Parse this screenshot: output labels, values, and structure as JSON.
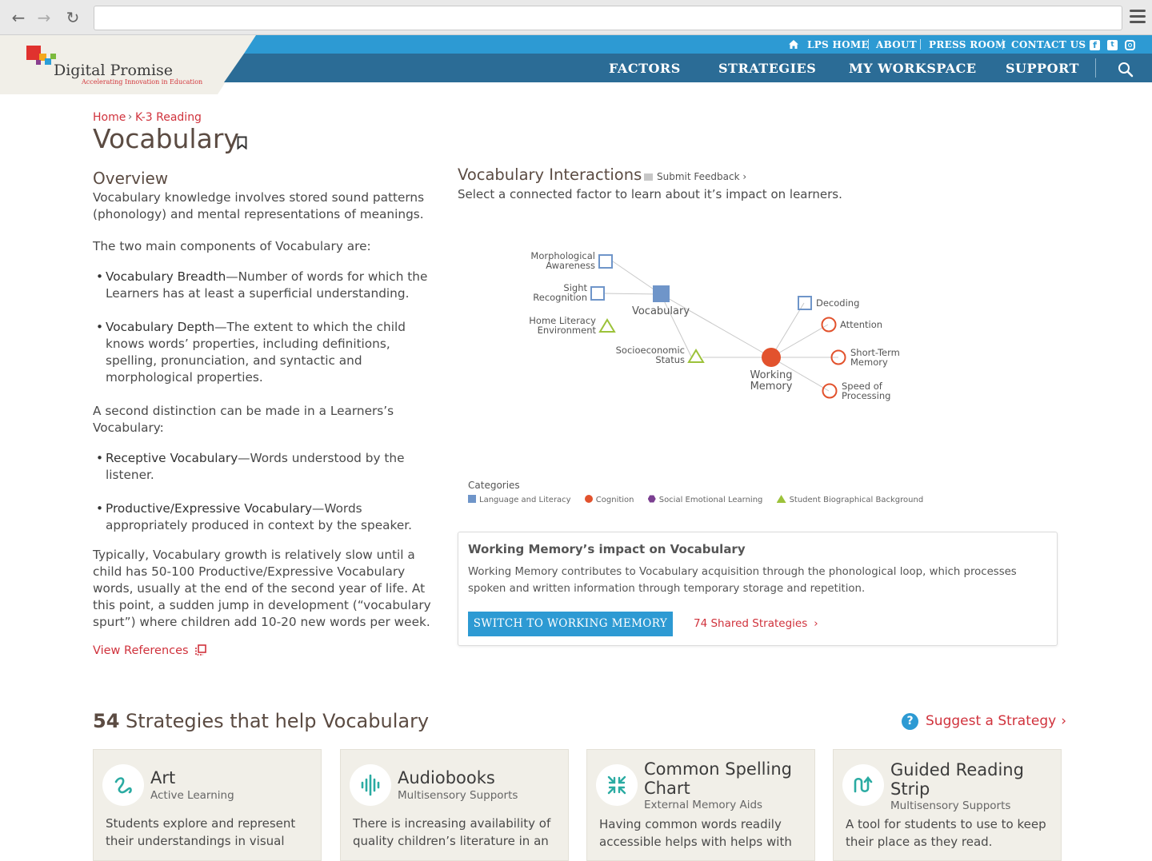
{
  "header": {
    "logo_title": "Digital Promise",
    "logo_tagline": "Accelerating Innovation in Education",
    "utility_links": [
      "LPS HOME",
      "ABOUT",
      "PRESS ROOM",
      "CONTACT US"
    ],
    "main_nav": [
      "FACTORS",
      "STRATEGIES",
      "MY WORKSPACE",
      "SUPPORT"
    ]
  },
  "breadcrumb": {
    "home": "Home",
    "sep": "›",
    "current": "K-3 Reading"
  },
  "page": {
    "title": "Vocabulary"
  },
  "overview": {
    "heading": "Overview",
    "intro": "Vocabulary knowledge involves stored sound patterns (phonology) and mental representations of meanings.",
    "components_intro": "The two main components of Vocabulary are:",
    "components": [
      {
        "term": "Vocabulary Breadth",
        "desc": "—Number of words for which the Learners has at least a superficial understanding."
      },
      {
        "term": "Vocabulary Depth",
        "desc": "—The extent to which the child knows words’ properties, including definitions, spelling, pronunciation, and syntactic and morphological properties."
      }
    ],
    "distinction_intro": "A second distinction can be made in a Learners’s Vocabulary:",
    "distinctions": [
      {
        "term": "Receptive Vocabulary",
        "desc": "—Words understood by the listener."
      },
      {
        "term": "Productive/Expressive Vocabulary",
        "desc": "—Words appropriately produced in context by the speaker."
      }
    ],
    "closing": "Typically, Vocabulary growth is relatively slow until a child has 50-100 Productive/Expressive Vocabulary words, usually at the end of the second year of life. At this point, a sudden jump in development (“vocabulary spurt”) where children add 10-20 new words per week.",
    "view_references": "View References"
  },
  "interactions": {
    "title": "Vocabulary Interactions",
    "feedback": "Submit Feedback ›",
    "subtitle": "Select a connected factor to learn about it’s impact on learners.",
    "nodes": {
      "morph_1": "Morphological",
      "morph_2": "Awareness",
      "sight_1": "Sight",
      "sight_2": "Recognition",
      "home_1": "Home Literacy",
      "home_2": "Environment",
      "socio_1": "Socioeconomic",
      "socio_2": "Status",
      "vocab": "Vocabulary",
      "wm_1": "Working",
      "wm_2": "Memory",
      "decoding": "Decoding",
      "attention": "Attention",
      "stm_1": "Short-Term",
      "stm_2": "Memory",
      "sop_1": "Speed of",
      "sop_2": "Processing"
    },
    "categories_label": "Categories",
    "categories": [
      {
        "name": "Language and Literacy",
        "color": "#6f95c9"
      },
      {
        "name": "Cognition",
        "color": "#e2522d"
      },
      {
        "name": "Social Emotional Learning",
        "color": "#7b3f91"
      },
      {
        "name": "Student Biographical Background",
        "color": "#9cc23a"
      }
    ]
  },
  "impact": {
    "title": "Working Memory’s impact on Vocabulary",
    "body": "Working Memory contributes to Vocabulary acquisition through the phonological loop, which processes spoken and written information through temporary storage and repetition.",
    "button": "SWITCH TO WORKING MEMORY",
    "shared": "74 Shared Strategies"
  },
  "strategies": {
    "count": "54",
    "heading": " Strategies that help Vocabulary",
    "suggest": "Suggest a Strategy",
    "cards": [
      {
        "title": "Art",
        "subtitle": "Active Learning",
        "desc": "Students explore and represent their understandings in visual"
      },
      {
        "title": "Audiobooks",
        "subtitle": "Multisensory Supports",
        "desc": "There is increasing availability of quality children’s literature in an"
      },
      {
        "title_1": "Common Spelling",
        "title_2": "Chart",
        "subtitle": "External Memory Aids",
        "desc": "Having common words readily accessible helps with helps with"
      },
      {
        "title_1": "Guided Reading",
        "title_2": "Strip",
        "subtitle": "Multisensory Supports",
        "desc": "A tool for students to use to keep their place as they read."
      }
    ]
  },
  "colors": {
    "accent_red": "#d0323c",
    "accent_blue": "#2d9ad3",
    "nav_blue": "#2b6c96",
    "teal_icon": "#2aaba2"
  }
}
